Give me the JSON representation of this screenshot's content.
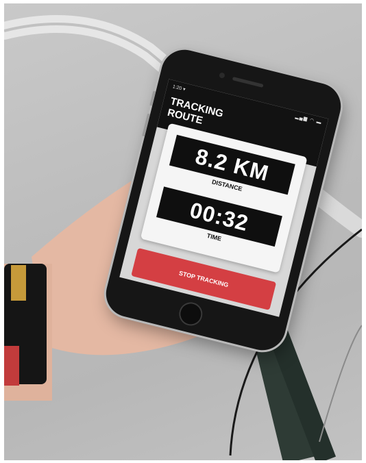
{
  "status_bar": {
    "time": "1:20 ▾",
    "indicators": "▂▄▆ ◠ ▬"
  },
  "app": {
    "title_line1": "TRACKING",
    "title_line2": "ROUTE"
  },
  "distance": {
    "value": "8.2 KM",
    "label": "DISTANCE"
  },
  "time": {
    "value": "00:32",
    "label": "TIME"
  },
  "actions": {
    "stop_label": "STOP TRACKING"
  },
  "colors": {
    "accent": "#d43f43",
    "header": "#121212",
    "metric_bg": "#0f0f0f"
  }
}
